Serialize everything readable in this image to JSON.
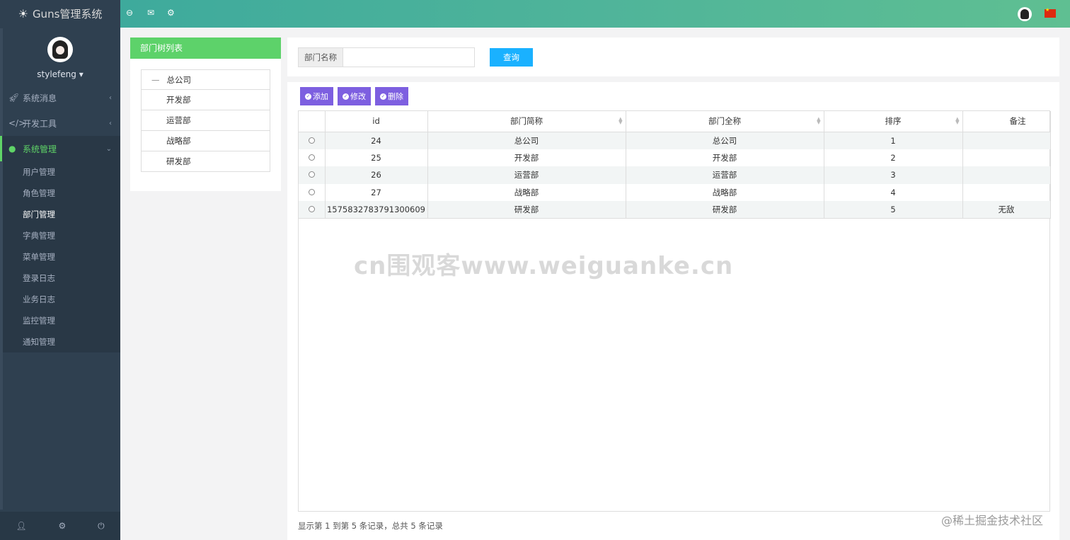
{
  "app": {
    "title": "Guns管理系统"
  },
  "user": {
    "name": "stylefeng"
  },
  "sidebar": {
    "items": [
      {
        "label": "系统消息",
        "icon": "rocket-icon"
      },
      {
        "label": "开发工具",
        "icon": "code-icon"
      },
      {
        "label": "系统管理",
        "icon": "user-icon"
      }
    ],
    "submenu": [
      "用户管理",
      "角色管理",
      "部门管理",
      "字典管理",
      "菜单管理",
      "登录日志",
      "业务日志",
      "监控管理",
      "通知管理"
    ]
  },
  "tree": {
    "title": "部门树列表",
    "root": "总公司",
    "children": [
      "开发部",
      "运营部",
      "战略部",
      "研发部"
    ]
  },
  "search": {
    "label": "部门名称",
    "value": "",
    "button": "查询"
  },
  "toolbar": {
    "add": "添加",
    "edit": "修改",
    "delete": "删除"
  },
  "table": {
    "columns": [
      "id",
      "部门简称",
      "部门全称",
      "排序",
      "备注"
    ],
    "rows": [
      [
        "24",
        "总公司",
        "总公司",
        "1",
        ""
      ],
      [
        "25",
        "开发部",
        "开发部",
        "2",
        ""
      ],
      [
        "26",
        "运营部",
        "运营部",
        "3",
        ""
      ],
      [
        "27",
        "战略部",
        "战略部",
        "4",
        ""
      ],
      [
        "1575832783791300609",
        "研发部",
        "研发部",
        "5",
        "无敌"
      ]
    ]
  },
  "pager": {
    "text": "显示第 1 到第 5 条记录，总共 5 条记录"
  },
  "watermark": "cn围观客www.weiguanke.cn",
  "credit": "@稀土掘金技术社区",
  "colors": {
    "accent": "#5dd26a",
    "topbar": "#4fb49a",
    "primary": "#1ab1ff",
    "button": "#7d5fe0",
    "sidebar": "#2f4050"
  }
}
